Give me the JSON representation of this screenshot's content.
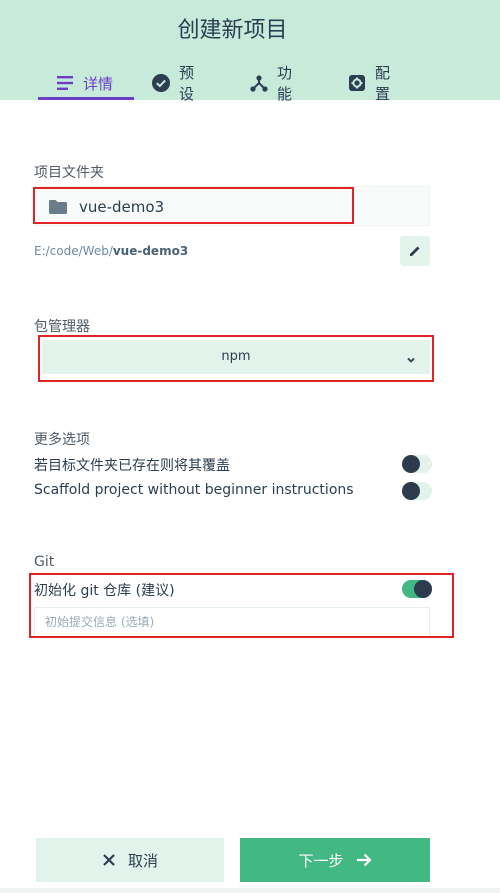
{
  "header": {
    "title": "创建新项目",
    "tabs": [
      {
        "label": "详情",
        "icon": "list-icon",
        "active": true
      },
      {
        "label": "预设",
        "icon": "check-circle-icon",
        "active": false
      },
      {
        "label": "功能",
        "icon": "branch-icon",
        "active": false
      },
      {
        "label": "配置",
        "icon": "gear-icon",
        "active": false
      }
    ]
  },
  "project_folder": {
    "label": "项目文件夹",
    "value": "vue-demo3",
    "path_prefix": "E:/code/Web/",
    "path_name": "vue-demo3"
  },
  "package_manager": {
    "label": "包管理器",
    "selected": "npm"
  },
  "more_options": {
    "label": "更多选项",
    "items": [
      {
        "label": "若目标文件夹已存在则将其覆盖",
        "enabled": false
      },
      {
        "label": "Scaffold project without beginner instructions",
        "enabled": false
      }
    ]
  },
  "git": {
    "label": "Git",
    "init_label": "初始化 git 仓库 (建议)",
    "init_enabled": true,
    "commit_placeholder": "初始提交信息 (选填)"
  },
  "footer": {
    "cancel_label": "取消",
    "next_label": "下一步"
  },
  "colors": {
    "header_bg": "#c7eadb",
    "accent_purple": "#6a3fc8",
    "primary_green": "#42b883",
    "highlight_red": "#e02424"
  }
}
